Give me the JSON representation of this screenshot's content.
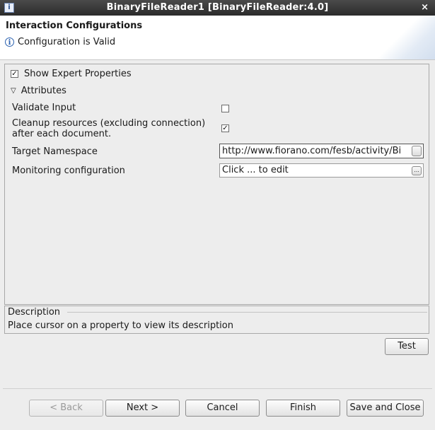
{
  "window": {
    "title": "BinaryFileReader1 [BinaryFileReader:4.0]",
    "close_glyph": "×",
    "app_icon_glyph": "i"
  },
  "header": {
    "title": "Interaction Configurations",
    "status": "Configuration is Valid",
    "status_icon": "info-icon"
  },
  "main": {
    "show_expert": {
      "label": "Show Expert Properties",
      "checked": true
    },
    "attributes_label": "Attributes",
    "properties": [
      {
        "label": "Validate Input",
        "type": "checkbox",
        "checked": false
      },
      {
        "label": "Cleanup resources (excluding connection) after each document.",
        "type": "checkbox",
        "checked": true
      },
      {
        "label": "Target Namespace",
        "type": "text",
        "value": "http://www.fiorano.com/fesb/activity/Bi"
      },
      {
        "label": "Monitoring configuration",
        "type": "text",
        "value": "Click ... to edit"
      }
    ]
  },
  "description": {
    "legend": "Description",
    "text": "Place cursor on a property to view its description"
  },
  "buttons": {
    "test": "Test",
    "back": "< Back",
    "next": "Next >",
    "cancel": "Cancel",
    "finish": "Finish",
    "save_close": "Save and Close"
  }
}
